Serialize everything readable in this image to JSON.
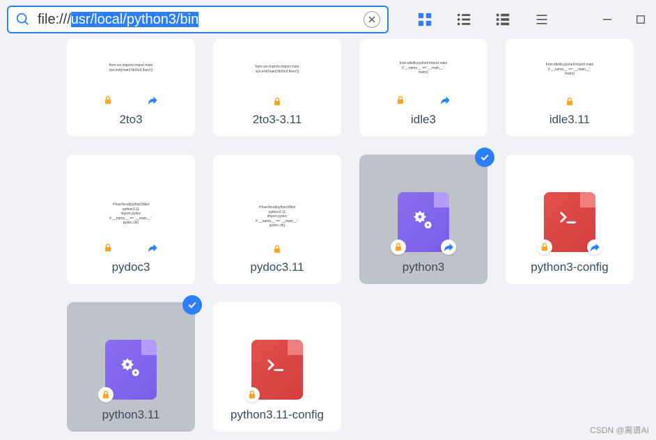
{
  "search": {
    "prefix": "file:///",
    "selected": "usr/local/python3/bin"
  },
  "files": [
    {
      "name": "2to3",
      "kind": "script",
      "lock": true,
      "share": true,
      "selected": false,
      "cut": true,
      "thumb": "from six.imports import main\nsys.exit(main('lib2to3.fixes'))"
    },
    {
      "name": "2to3-3.11",
      "kind": "script",
      "lock": true,
      "share": false,
      "selected": false,
      "cut": true,
      "thumb": "from six.imports import main\nsys.exit(main('lib2to3.fixes'))"
    },
    {
      "name": "idle3",
      "kind": "script",
      "lock": true,
      "share": true,
      "selected": false,
      "cut": true,
      "thumb": "from idlelib.pyshell import main\nif __name__ == '__main__':\n  main()"
    },
    {
      "name": "idle3.11",
      "kind": "script",
      "lock": true,
      "share": false,
      "selected": false,
      "cut": true,
      "thumb": "from idlelib.pyshell import main\nif __name__ == '__main__':\n  main()"
    },
    {
      "name": "pydoc3",
      "kind": "script",
      "lock": true,
      "share": true,
      "selected": false,
      "cut": false,
      "thumb": "#!/usr/local/python3/bin/\npython3.11\n\nimport pydoc\nif __name__ == '__main__':\n  pydoc.cli()"
    },
    {
      "name": "pydoc3.11",
      "kind": "script",
      "lock": true,
      "share": false,
      "selected": false,
      "cut": false,
      "thumb": "#!/usr/local/python3/bin/\npython3.11\n\nimport pydoc\nif __name__ == '__main__':\n  pydoc.cli()"
    },
    {
      "name": "python3",
      "kind": "binary-purple",
      "lock": true,
      "share": true,
      "selected": true,
      "cut": false
    },
    {
      "name": "python3-config",
      "kind": "binary-red",
      "lock": true,
      "share": true,
      "selected": false,
      "cut": false
    },
    {
      "name": "python3.11",
      "kind": "binary-purple",
      "lock": true,
      "share": false,
      "selected": true,
      "cut": false
    },
    {
      "name": "python3.11-config",
      "kind": "binary-red",
      "lock": true,
      "share": false,
      "selected": false,
      "cut": false
    }
  ],
  "watermark": "CSDN @离谱AI"
}
